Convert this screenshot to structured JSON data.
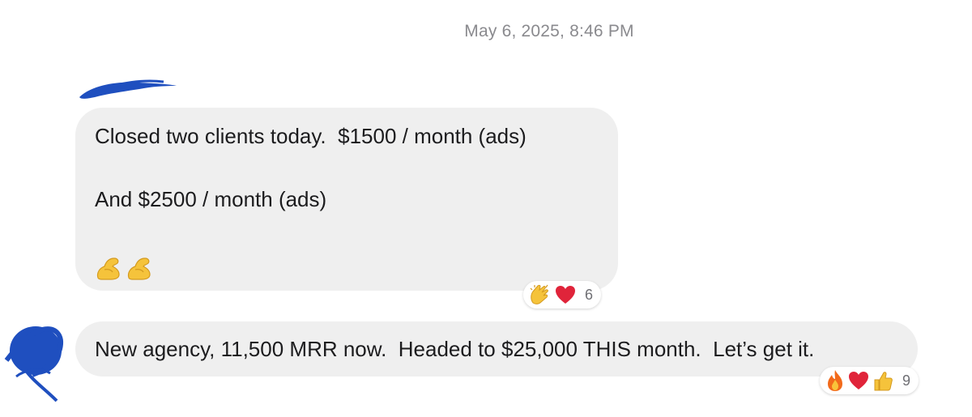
{
  "conversation": {
    "timestamp": "May 6, 2025, 8:46 PM"
  },
  "messages": [
    {
      "lines": [
        "Closed two clients today.  $1500 / month (ads)",
        "",
        "And $2500 / month (ads)",
        ""
      ],
      "emoji": [
        "flexed-biceps",
        "flexed-biceps"
      ],
      "reactions": {
        "icons": [
          "clapping-hands-icon",
          "red-heart-icon"
        ],
        "count": "6"
      }
    },
    {
      "text": "New agency, 11,500 MRR now.  Headed to $25,000 THIS month.  Let’s get it.",
      "reactions": {
        "icons": [
          "fire-icon",
          "red-heart-icon",
          "thumbs-up-icon"
        ],
        "count": "9"
      }
    }
  ],
  "colors": {
    "bubble_bg": "#efefef",
    "timestamp": "#8a8a8e",
    "redaction_scribble": "#1f4fbf",
    "heart": "#e0243a",
    "emoji_yellow": "#f5c33b"
  }
}
